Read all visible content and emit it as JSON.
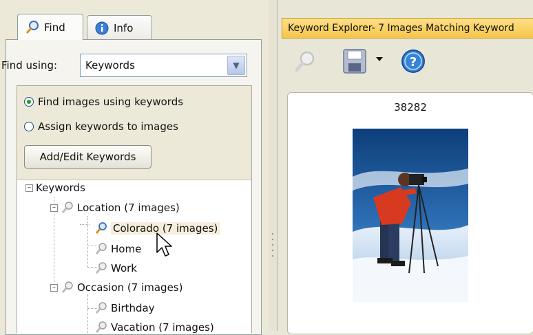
{
  "tabs": [
    {
      "label": "Find",
      "icon": "magnifier-key-icon"
    },
    {
      "label": "Info",
      "icon": "info-icon"
    }
  ],
  "find_using": {
    "label": "Find using:",
    "value": "Keywords"
  },
  "radios": [
    {
      "label": "Find images using keywords",
      "checked": true
    },
    {
      "label": "Assign keywords to images",
      "checked": false
    }
  ],
  "add_edit_button": "Add/Edit Keywords",
  "tree": {
    "root": "Keywords",
    "location": "Location (7 images)",
    "colorado": "Colorado (7 images)",
    "home": "Home",
    "work": "Work",
    "occasion": "Occasion (7 images)",
    "birthday": "Birthday",
    "vacation": "Vacation (7 images)"
  },
  "explorer": {
    "title": "Keyword Explorer- 7 Images Matching Keyword",
    "thumbnail_id": "38282"
  },
  "toolbar": {
    "icons": [
      "find-key-icon",
      "save-icon",
      "dropdown-arrow-icon",
      "help-icon"
    ]
  }
}
